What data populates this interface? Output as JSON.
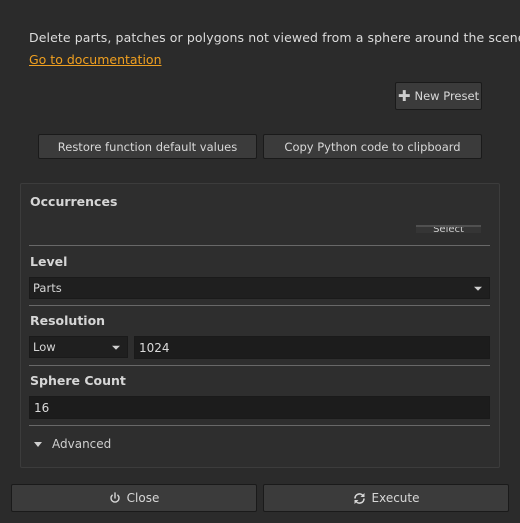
{
  "header": {
    "description": "Delete parts, patches or polygons not viewed from a sphere around the scene",
    "doc_link": "Go to documentation"
  },
  "toolbar": {
    "new_preset_label": "New Preset",
    "restore_label": "Restore function default values",
    "copy_label": "Copy Python code to clipboard"
  },
  "occurrences": {
    "title": "Occurrences",
    "select_label": "Select"
  },
  "level": {
    "title": "Level",
    "selected": "Parts"
  },
  "resolution": {
    "title": "Resolution",
    "preset": "Low",
    "value": "1024"
  },
  "sphere_count": {
    "title": "Sphere Count",
    "value": "16"
  },
  "advanced": {
    "label": "Advanced"
  },
  "footer": {
    "close_label": "Close",
    "execute_label": "Execute"
  },
  "colors": {
    "background": "#2b2b2b",
    "link": "#f0a020",
    "field": "#1c1c1c"
  }
}
